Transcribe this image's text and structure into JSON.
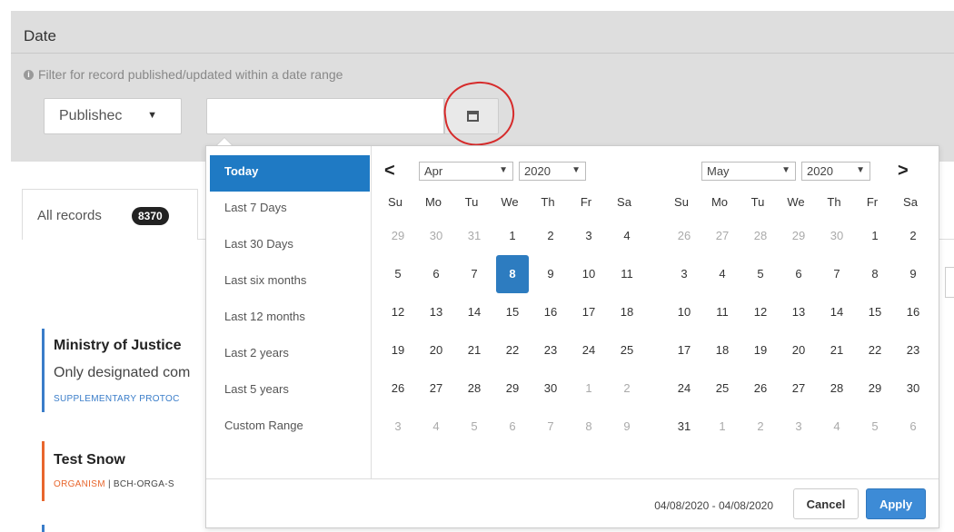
{
  "filter": {
    "title": "Date",
    "hint": "Filter for record published/updated within a date range",
    "select_value": "Publishec",
    "date_input_value": ""
  },
  "tabs": {
    "all_label": "All records",
    "all_count": "8370"
  },
  "records": [
    {
      "title": "Ministry of Justice",
      "desc": "Only designated com",
      "tag": "SUPPLEMENTARY PROTOC",
      "color": "#3a7dc9"
    },
    {
      "title": "Test Snow",
      "tag_main": "ORGANISM",
      "tag_sep": " | ",
      "tag_rest": "BCH-ORGA-S",
      "color": "#e8662d"
    }
  ],
  "picker": {
    "ranges": [
      "Today",
      "Last 7 Days",
      "Last 30 Days",
      "Last six months",
      "Last 12 months",
      "Last 2 years",
      "Last 5 years",
      "Custom Range"
    ],
    "active_range": "Today",
    "weekdays": [
      "Su",
      "Mo",
      "Tu",
      "We",
      "Th",
      "Fr",
      "Sa"
    ],
    "left": {
      "prev_arrow": "<",
      "month": "Apr",
      "year": "2020",
      "days": [
        [
          "29",
          "30",
          "31",
          "1",
          "2",
          "3",
          "4"
        ],
        [
          "5",
          "6",
          "7",
          "8",
          "9",
          "10",
          "11"
        ],
        [
          "12",
          "13",
          "14",
          "15",
          "16",
          "17",
          "18"
        ],
        [
          "19",
          "20",
          "21",
          "22",
          "23",
          "24",
          "25"
        ],
        [
          "26",
          "27",
          "28",
          "29",
          "30",
          "1",
          "2"
        ],
        [
          "3",
          "4",
          "5",
          "6",
          "7",
          "8",
          "9"
        ]
      ],
      "off": [
        [
          0,
          0
        ],
        [
          0,
          1
        ],
        [
          0,
          2
        ],
        [
          4,
          5
        ],
        [
          4,
          6
        ],
        [
          5,
          0
        ],
        [
          5,
          1
        ],
        [
          5,
          2
        ],
        [
          5,
          3
        ],
        [
          5,
          4
        ],
        [
          5,
          5
        ],
        [
          5,
          6
        ]
      ],
      "selected": [
        1,
        3
      ]
    },
    "right": {
      "next_arrow": ">",
      "month": "May",
      "year": "2020",
      "days": [
        [
          "26",
          "27",
          "28",
          "29",
          "30",
          "1",
          "2"
        ],
        [
          "3",
          "4",
          "5",
          "6",
          "7",
          "8",
          "9"
        ],
        [
          "10",
          "11",
          "12",
          "13",
          "14",
          "15",
          "16"
        ],
        [
          "17",
          "18",
          "19",
          "20",
          "21",
          "22",
          "23"
        ],
        [
          "24",
          "25",
          "26",
          "27",
          "28",
          "29",
          "30"
        ],
        [
          "31",
          "1",
          "2",
          "3",
          "4",
          "5",
          "6"
        ]
      ],
      "off": [
        [
          0,
          0
        ],
        [
          0,
          1
        ],
        [
          0,
          2
        ],
        [
          0,
          3
        ],
        [
          0,
          4
        ],
        [
          5,
          1
        ],
        [
          5,
          2
        ],
        [
          5,
          3
        ],
        [
          5,
          4
        ],
        [
          5,
          5
        ],
        [
          5,
          6
        ]
      ]
    },
    "range_text": "04/08/2020 - 04/08/2020",
    "cancel_label": "Cancel",
    "apply_label": "Apply"
  },
  "colors": {
    "accent": "#1f7ac4",
    "selected_day": "#2d7cc0",
    "apply": "#3d8bd6",
    "annotation": "#d62b2b"
  }
}
